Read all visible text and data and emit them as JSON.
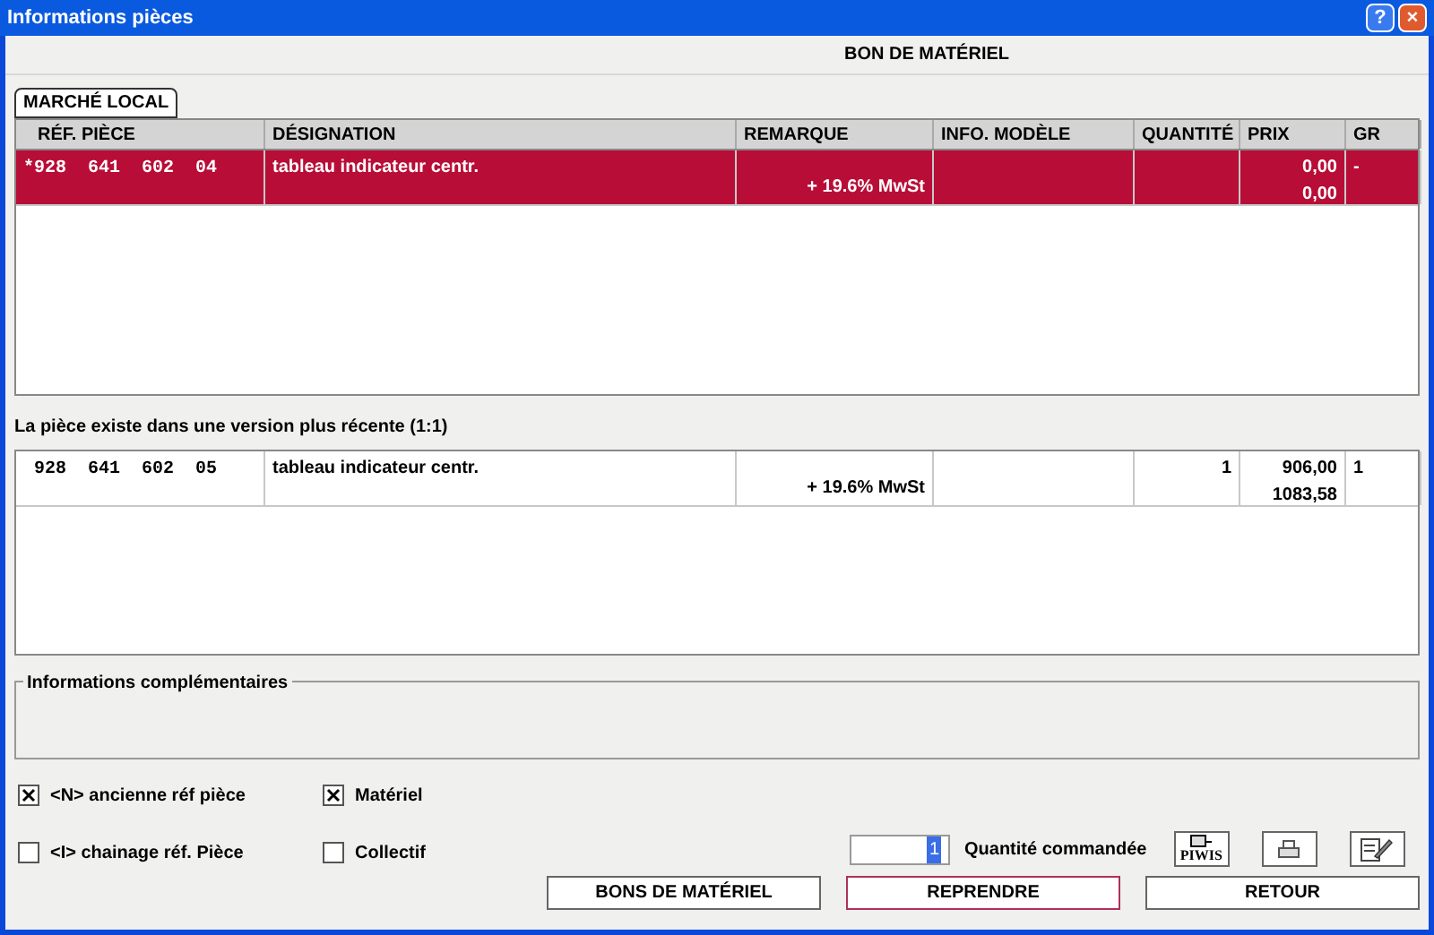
{
  "window": {
    "title": "Informations pièces",
    "buttons": [
      "?",
      "×"
    ]
  },
  "header": "BON DE MATÉRIEL",
  "tabs": [
    {
      "label": "MARCHÉ LOCAL",
      "selected": true
    }
  ],
  "table": {
    "columns": [
      "RÉF. PIÈCE",
      "DÉSIGNATION",
      "REMARQUE",
      "INFO. MODÈLE",
      "QUANTITÉ",
      "PRIX",
      "GR"
    ],
    "rows": [
      {
        "selected": true,
        "ref": "*928  641  602  04",
        "designation": "tableau indicateur centr.",
        "remarque": "+ 19.6% MwSt",
        "quantite": "",
        "prix": [
          "0,00",
          "0,00"
        ],
        "gr": "-"
      }
    ]
  },
  "section_label": "La pièce existe dans une version plus récente (1:1)",
  "table2": {
    "rows": [
      {
        "selected": false,
        "ref": " 928  641  602  05",
        "designation": "tableau indicateur centr.",
        "remarque": "+ 19.6% MwSt",
        "quantite": "1",
        "prix": [
          "906,00",
          "1083,58"
        ],
        "gr": "1"
      }
    ]
  },
  "info_group": {
    "label": "Informations complémentaires"
  },
  "checkboxes": [
    {
      "label": "<N> ancienne réf pièce",
      "checked": true
    },
    {
      "label": "Matériel",
      "checked": true
    },
    {
      "label": "<I> chainage réf. Pièce",
      "checked": false
    },
    {
      "label": "Collectif",
      "checked": false
    }
  ],
  "quantity": {
    "value": "1",
    "label": "Quantité commandée"
  },
  "tool_buttons": [
    {
      "kind": "piwis",
      "label": "PIWIS"
    },
    {
      "kind": "print"
    },
    {
      "kind": "edit"
    }
  ],
  "buttons": [
    {
      "label": "BONS DE MATÉRIEL",
      "selected": false
    },
    {
      "label": "REPRENDRE",
      "selected": true
    },
    {
      "label": "RETOUR",
      "selected": false
    }
  ]
}
